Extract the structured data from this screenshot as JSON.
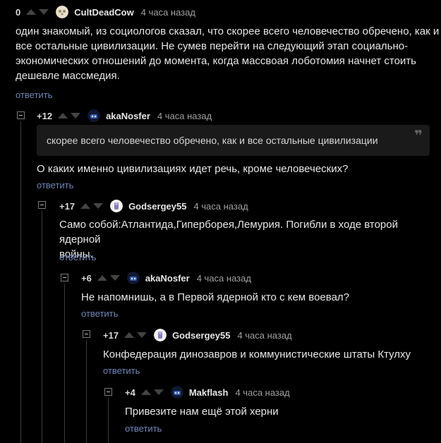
{
  "reply_label": "ответить",
  "comments": [
    {
      "rating": "0",
      "author": "CultDeadCow",
      "time": "4 часа назад",
      "lines": [
        "один знакомый, из социологов сказал, что скорее всего человечество обречено, как и",
        "все остальные цивилизации. Не сумев перейти на следующий этап социально-",
        "экономических отношений до момента, когда массвоая лоботомия начнет стоить",
        "дешевле массмедия."
      ]
    },
    {
      "rating": "+12",
      "author": "akaNosfer",
      "time": "4 часа назад",
      "quote": "скорее всего человечество обречено, как и все остальные цивилизации",
      "lines": [
        "О каких именно цивилизациях идет речь, кроме человеческих?"
      ]
    },
    {
      "rating": "+17",
      "author": "Godsergey55",
      "time": "4 часа назад",
      "lines": [
        "Само собой:Атлантида,Гиперборея,Лемурия. Погибли в ходе второй ядерной",
        "войны."
      ]
    },
    {
      "rating": "+6",
      "author": "akaNosfer",
      "time": "4 часа назад",
      "lines": [
        "Не напомнишь, а в Первой ядерной кто с кем воевал?"
      ]
    },
    {
      "rating": "+17",
      "author": "Godsergey55",
      "time": "4 часа назад",
      "lines": [
        "Конфедерация динозавров и коммунистические штаты Ктулху"
      ]
    },
    {
      "rating": "+4",
      "author": "Makflash",
      "time": "4 часа назад",
      "lines": [
        "Привезите нам ещё этой херни"
      ]
    }
  ]
}
